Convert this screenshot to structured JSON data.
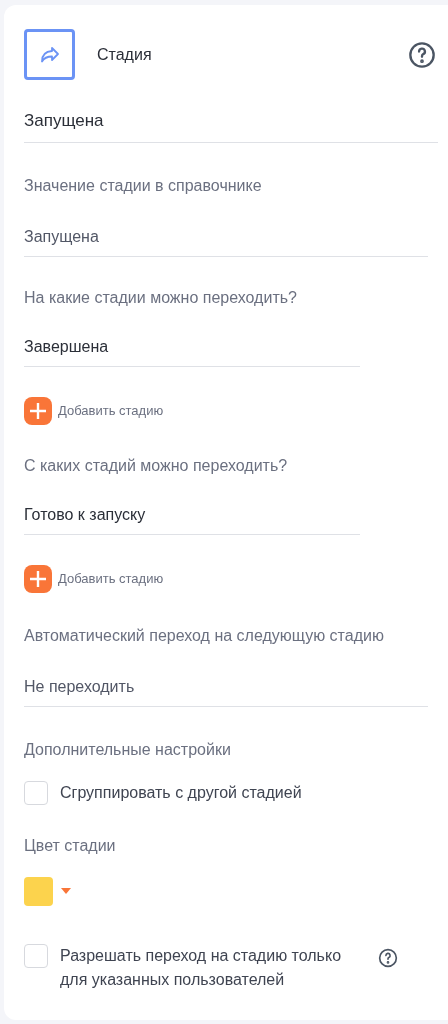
{
  "header": {
    "title": "Стадия"
  },
  "name_field": {
    "value": "Запущена"
  },
  "sections": [
    {
      "kind": "select",
      "label": "Значение стадии в справочнике",
      "value": "Запущена"
    },
    {
      "kind": "list",
      "label": "На какие стадии можно переходить?",
      "items": [
        "Завершена"
      ],
      "add": "Добавить стадию"
    },
    {
      "kind": "list",
      "label": "С каких стадий можно переходить?",
      "items": [
        "Готово к запуску"
      ],
      "add": "Добавить стадию"
    },
    {
      "kind": "select",
      "label": "Автоматический переход на следующую стадию",
      "value": "Не переходить"
    },
    {
      "kind": "checks",
      "label": "Дополнительные настройки",
      "checks": [
        {
          "label": "Сгруппировать с другой стадией",
          "checked": false
        }
      ]
    },
    {
      "kind": "color",
      "label": "Цвет стадии",
      "color": "#fcd34d"
    },
    {
      "kind": "checks",
      "checks": [
        {
          "label": "Разрешать переход на стадию только для указанных пользователей",
          "checked": false,
          "help": true
        }
      ]
    }
  ]
}
